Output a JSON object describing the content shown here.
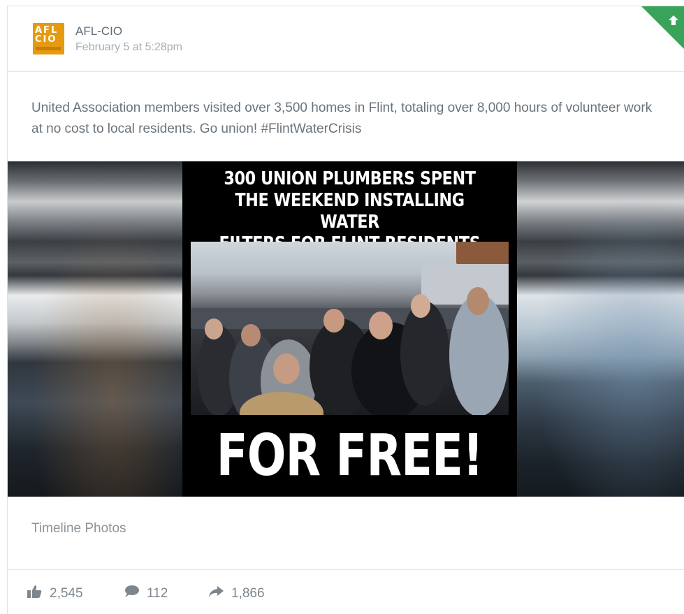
{
  "post": {
    "page_logo_lines": [
      "AFL",
      "CIO"
    ],
    "author": "AFL-CIO",
    "timestamp": "February 5 at 5:28pm",
    "message": "United Association members visited over 3,500 homes in Flint, totaling over 8,000 hours of volunteer work at no cost to local residents. Go union! #FlintWaterCrisis",
    "image": {
      "headline_lines": [
        "300 UNION PLUMBERS SPENT",
        "THE WEEKEND INSTALLING WATER",
        "FILTERS FOR FLINT RESIDENTS"
      ],
      "footer_text": "FOR FREE!"
    },
    "caption": "Timeline Photos"
  },
  "stats": {
    "likes": "2,545",
    "comments": "112",
    "shares": "1,866"
  },
  "icons": {
    "corner": "up-arrow-icon",
    "likes": "thumbs-up-icon",
    "comments": "speech-bubble-icon",
    "shares": "share-arrow-icon"
  },
  "colors": {
    "logo_bg": "#e69a10",
    "corner_badge": "#3aa35a",
    "muted_text": "#6a737b"
  }
}
